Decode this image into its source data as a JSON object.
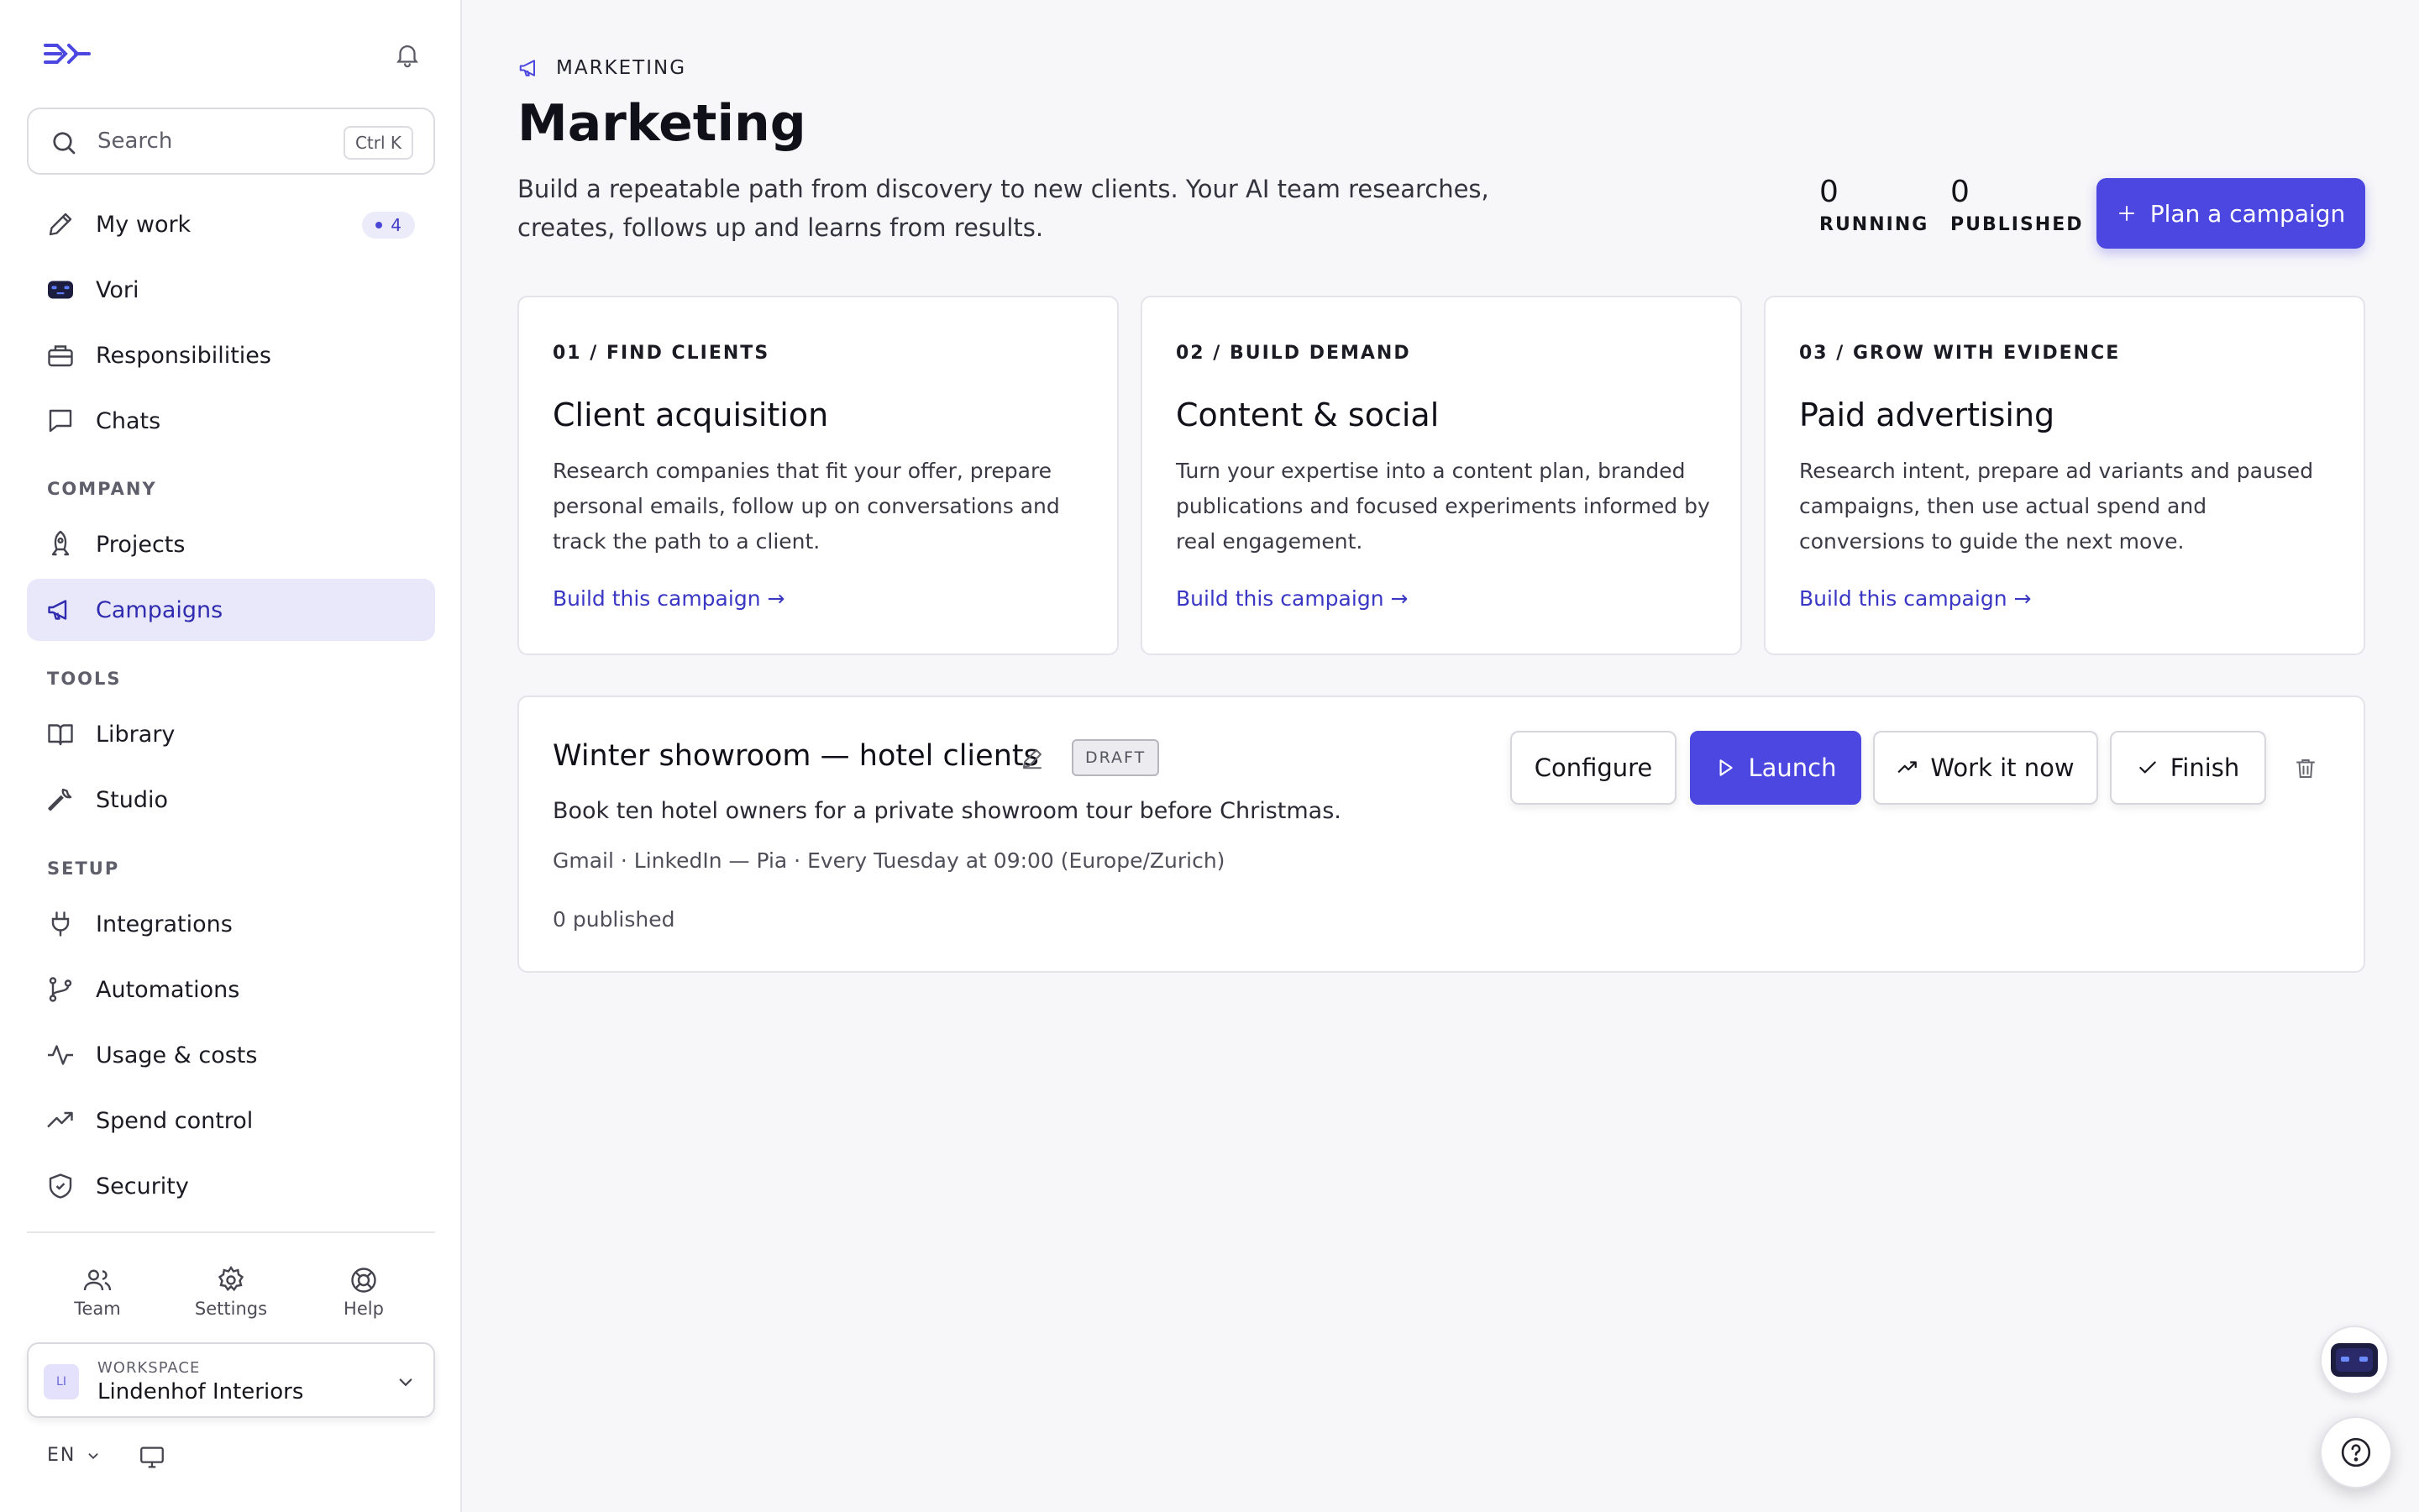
{
  "colors": {
    "accent": "#4b47e0",
    "active_bg": "#e9e8fb",
    "link": "#3a37c4"
  },
  "sidebar": {
    "search": {
      "placeholder": "Search",
      "shortcut": "Ctrl K"
    },
    "items": [
      {
        "label": "My work",
        "icon": "pencil-icon",
        "badge": "4"
      },
      {
        "label": "Vori",
        "icon": "bot-icon"
      },
      {
        "label": "Responsibilities",
        "icon": "briefcase-icon"
      },
      {
        "label": "Chats",
        "icon": "chat-icon"
      }
    ],
    "sections": [
      {
        "title": "COMPANY",
        "items": [
          {
            "label": "Projects",
            "icon": "rocket-icon"
          },
          {
            "label": "Campaigns",
            "icon": "megaphone-icon",
            "active": true
          }
        ]
      },
      {
        "title": "TOOLS",
        "items": [
          {
            "label": "Library",
            "icon": "book-icon"
          },
          {
            "label": "Studio",
            "icon": "wrench-icon"
          }
        ]
      },
      {
        "title": "SETUP",
        "items": [
          {
            "label": "Integrations",
            "icon": "plug-icon"
          },
          {
            "label": "Automations",
            "icon": "branch-icon"
          },
          {
            "label": "Usage & costs",
            "icon": "activity-icon"
          },
          {
            "label": "Spend control",
            "icon": "trending-icon"
          },
          {
            "label": "Security",
            "icon": "shield-icon"
          }
        ]
      }
    ],
    "utilities": [
      {
        "label": "Team",
        "icon": "users-icon"
      },
      {
        "label": "Settings",
        "icon": "gear-icon"
      },
      {
        "label": "Help",
        "icon": "lifebuoy-icon"
      }
    ],
    "workspace": {
      "initials": "LI",
      "label": "WORKSPACE",
      "name": "Lindenhof Interiors"
    },
    "language": "EN"
  },
  "header": {
    "breadcrumb": "MARKETING",
    "title": "Marketing",
    "description": "Build a repeatable path from discovery to new clients. Your AI team researches, creates, follows up and learns from results.",
    "stats": [
      {
        "value": "0",
        "label": "RUNNING"
      },
      {
        "value": "0",
        "label": "PUBLISHED"
      }
    ],
    "cta": "Plan a campaign"
  },
  "cards": [
    {
      "eyebrow": "01 / FIND CLIENTS",
      "title": "Client acquisition",
      "body": "Research companies that fit your offer, prepare personal emails, follow up on conversations and track the path to a client.",
      "link": "Build this campaign →"
    },
    {
      "eyebrow": "02 / BUILD DEMAND",
      "title": "Content & social",
      "body": "Turn your expertise into a content plan, branded publications and focused experiments informed by real engagement.",
      "link": "Build this campaign →"
    },
    {
      "eyebrow": "03 / GROW WITH EVIDENCE",
      "title": "Paid advertising",
      "body": "Research intent, prepare ad variants and paused campaigns, then use actual spend and conversions to guide the next move.",
      "link": "Build this campaign →"
    }
  ],
  "campaign": {
    "title": "Winter showroom — hotel clients",
    "status": "DRAFT",
    "description": "Book ten hotel owners for a private showroom tour before Christmas.",
    "meta": "Gmail · LinkedIn — Pia · Every Tuesday at 09:00 (Europe/Zurich)",
    "published": "0 published",
    "actions": {
      "configure": "Configure",
      "launch": "Launch",
      "work_now": "Work it now",
      "finish": "Finish"
    }
  }
}
